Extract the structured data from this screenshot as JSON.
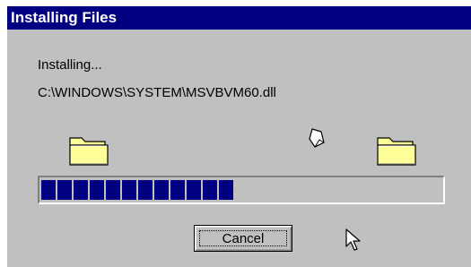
{
  "window": {
    "title": "Installing Files"
  },
  "status": {
    "label": "Installing...",
    "current_file": "C:\\WINDOWS\\SYSTEM\\MSVBVM60.dll"
  },
  "progress": {
    "fraction": 0.48,
    "color": "#000080"
  },
  "buttons": {
    "cancel_label": "Cancel"
  },
  "icons": {
    "source": "folder-icon",
    "destination": "folder-icon",
    "transfer": "flying-document-icon",
    "pointer": "mouse-cursor-icon"
  },
  "colors": {
    "titlebar": "#000080",
    "dialog_face": "#c0c0c0",
    "folder": "#ffff99"
  }
}
